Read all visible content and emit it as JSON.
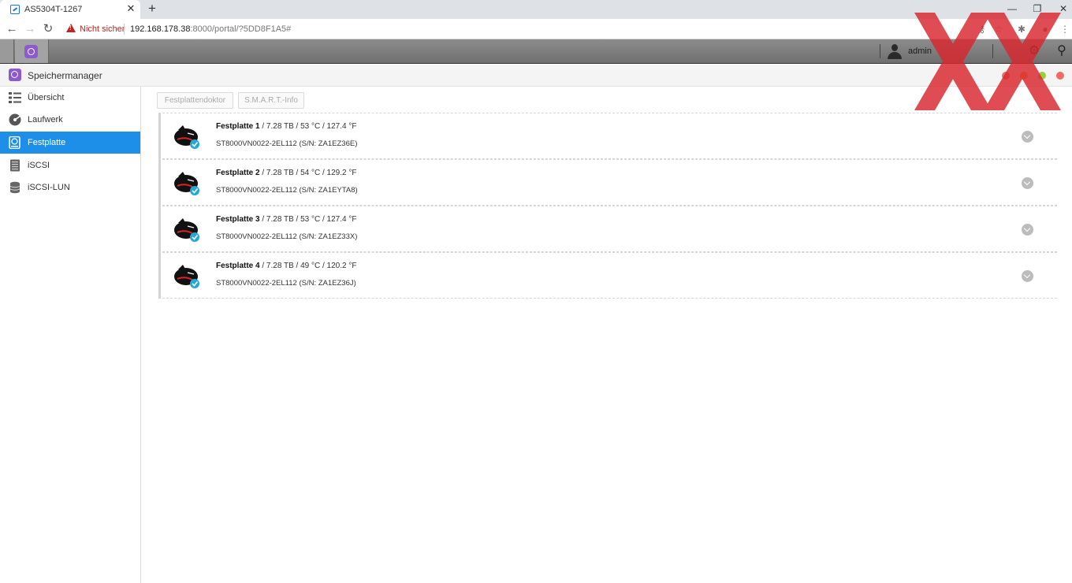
{
  "browser": {
    "tab_title": "AS5304T-1267",
    "tab_close": "✕",
    "new_tab": "+",
    "security_label": "Nicht sicher",
    "url_host": "192.168.178.38",
    "url_path": ":8000/portal/?5DD8F1A5#",
    "win_minimize": "—",
    "win_restore": "❐",
    "win_close": "✕"
  },
  "adm": {
    "user": "admin",
    "icons": [
      "gear-icon",
      "search-icon"
    ]
  },
  "window": {
    "title": "Speichermanager",
    "dot_colors": [
      "#e0736a",
      "#f0a63a",
      "#9ccc3d",
      "#f06a6a"
    ]
  },
  "sidebar": {
    "items": [
      {
        "label": "Übersicht",
        "icon": "overview-icon"
      },
      {
        "label": "Laufwerk",
        "icon": "volume-icon"
      },
      {
        "label": "Festplatte",
        "icon": "disk-icon",
        "active": true
      },
      {
        "label": "iSCSI",
        "icon": "iscsi-icon"
      },
      {
        "label": "iSCSI-LUN",
        "icon": "lun-icon"
      }
    ]
  },
  "toolbar": {
    "disk_doctor": "Festplattendoktor",
    "smart_info": "S.M.A.R.T.-Info"
  },
  "disks": [
    {
      "name": "Festplatte 1",
      "details": " / 7.28 TB / 53 °C / 127.4 °F",
      "model": "ST8000VN0022-2EL112 (S/N: ZA1EZ36E)"
    },
    {
      "name": "Festplatte 2",
      "details": " / 7.28 TB / 54 °C / 129.2 °F",
      "model": "ST8000VN0022-2EL112 (S/N: ZA1EYTA8)"
    },
    {
      "name": "Festplatte 3",
      "details": " / 7.28 TB / 53 °C / 127.4 °F",
      "model": "ST8000VN0022-2EL112 (S/N: ZA1EZ33X)"
    },
    {
      "name": "Festplatte 4",
      "details": " / 7.28 TB / 49 °C / 120.2 °F",
      "model": "ST8000VN0022-2EL112 (S/N: ZA1EZ36J)"
    }
  ]
}
